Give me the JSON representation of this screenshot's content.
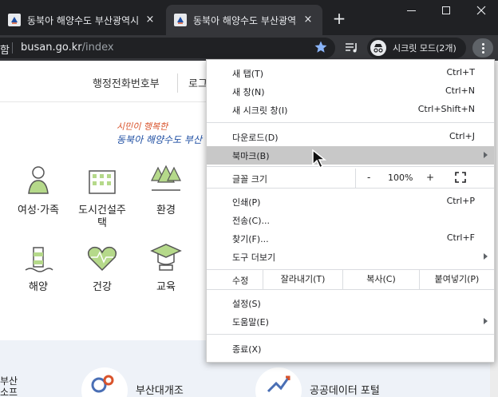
{
  "browser": {
    "tabs": [
      {
        "title": "동북아 해양수도 부산광역시",
        "active": false
      },
      {
        "title": "동북아 해양수도 부산광역시",
        "active": true
      }
    ],
    "newtab_label": "+",
    "close_glyph": "×",
    "omnibox": {
      "prefix": "함",
      "host": "busan.go.kr",
      "path": "/index"
    },
    "incognito_label": "시크릿 모드(2개)"
  },
  "page": {
    "topnav": [
      "행정전화번호부",
      "로그"
    ],
    "slogan": {
      "line1": "시민이 행복한",
      "line2": "동북아 해양수도 부산"
    },
    "categories": [
      {
        "label": "여성·가족",
        "icon": "family-icon"
      },
      {
        "label": "도시건설주택",
        "icon": "building-icon"
      },
      {
        "label": "환경",
        "icon": "tree-icon"
      },
      {
        "label": "해양",
        "icon": "lighthouse-icon"
      },
      {
        "label": "건강",
        "icon": "heart-icon"
      },
      {
        "label": "교육",
        "icon": "graduation-cap-icon"
      }
    ],
    "band": {
      "left_text": "부산\n소프",
      "item1": "부산대개조",
      "item2": "공공데이터 포털"
    }
  },
  "menu": {
    "items_top": [
      {
        "label": "새 탭(T)",
        "shortcut": "Ctrl+T"
      },
      {
        "label": "새 창(N)",
        "shortcut": "Ctrl+N"
      },
      {
        "label": "새 시크릿 창(I)",
        "shortcut": "Ctrl+Shift+N"
      }
    ],
    "items_mid": [
      {
        "label": "다운로드(D)",
        "shortcut": "Ctrl+J"
      },
      {
        "label": "북마크(B)",
        "shortcut": ""
      }
    ],
    "zoom": {
      "label": "글꼴 크기",
      "minus": "-",
      "value": "100%",
      "plus": "+"
    },
    "items_tools": [
      {
        "label": "인쇄(P)",
        "shortcut": "Ctrl+P"
      },
      {
        "label": "전송(C)...",
        "shortcut": ""
      },
      {
        "label": "찾기(F)...",
        "shortcut": "Ctrl+F"
      },
      {
        "label": "도구 더보기",
        "shortcut": ""
      }
    ],
    "edit": {
      "label": "수정",
      "cut": "잘라내기(T)",
      "copy": "복사(C)",
      "paste": "붙여넣기(P)"
    },
    "items_settings": [
      {
        "label": "설정(S)",
        "shortcut": ""
      },
      {
        "label": "도움말(E)",
        "shortcut": ""
      }
    ],
    "exit": {
      "label": "종료(X)"
    }
  }
}
